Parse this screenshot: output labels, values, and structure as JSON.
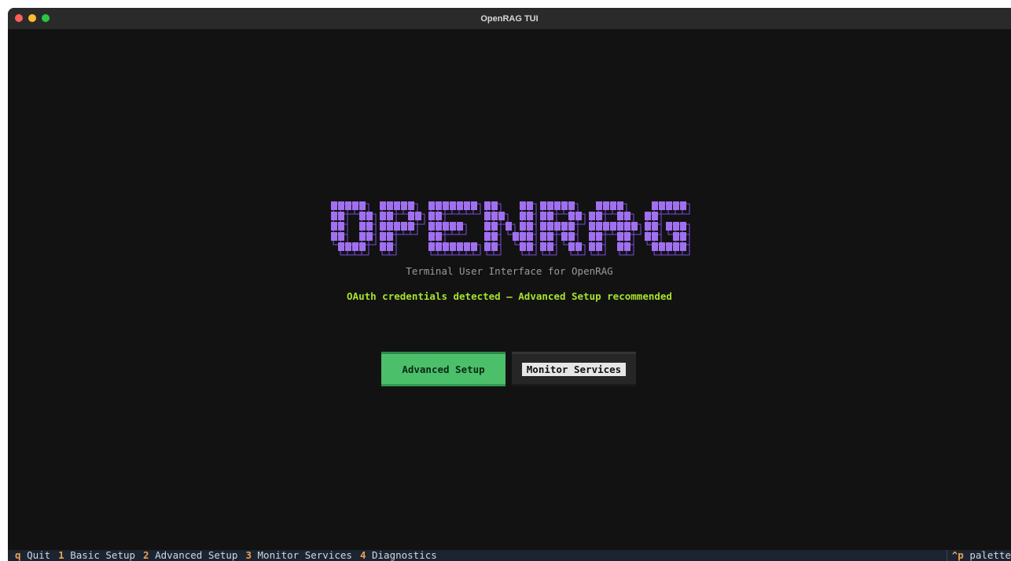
{
  "window": {
    "title": "OpenRAG TUI"
  },
  "logo": {
    "text": "OPENRAG",
    "color": "#a070f0",
    "outline_color": "#7a4ee0"
  },
  "header": {
    "subtitle": "Terminal User Interface for OpenRAG",
    "notice": "OAuth credentials detected — Advanced Setup recommended"
  },
  "buttons": {
    "advanced_setup": "Advanced Setup",
    "monitor_services": "Monitor Services"
  },
  "footer": {
    "bindings": [
      {
        "key": "q",
        "label": "Quit"
      },
      {
        "key": "1",
        "label": "Basic Setup"
      },
      {
        "key": "2",
        "label": "Advanced Setup"
      },
      {
        "key": "3",
        "label": "Monitor Services"
      },
      {
        "key": "4",
        "label": "Diagnostics"
      }
    ],
    "palette": {
      "key": "^p",
      "label": "palette"
    }
  },
  "colors": {
    "accent_green": "#4cbf6a",
    "notice_green": "#a6e22e",
    "footer_key": "#f0a04b"
  }
}
